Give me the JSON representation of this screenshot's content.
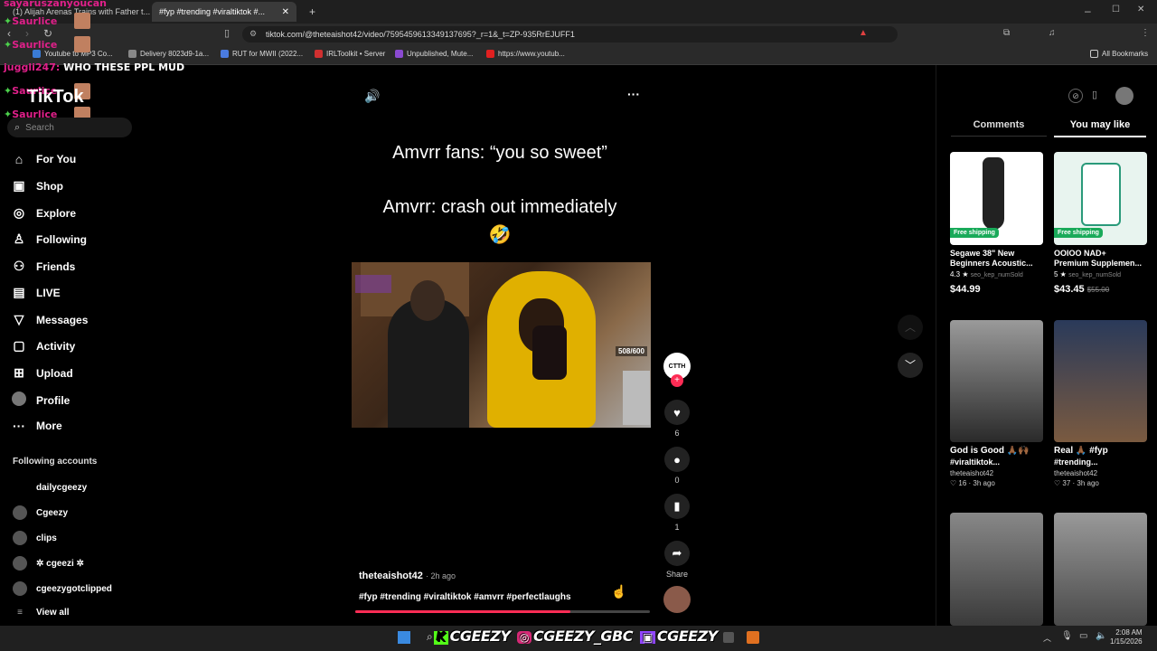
{
  "browser": {
    "tabs": [
      {
        "label": "(1) Alijah Arenas Trains with Father t..."
      },
      {
        "label": "#fyp #trending #viraltiktok #..."
      }
    ],
    "new_tab": "+",
    "url": "tiktok.com/@theteaishot42/video/7595459613349137695?_r=1&_t=ZP-935RrEJUFF1",
    "bookmarks": [
      "Youtube to MP3 Co...",
      "Delivery 8023d9-1a...",
      "RUT for MWII (2022...",
      "IRLToolkit • Server",
      "Unpublished, Mute...",
      "https://www.youtub..."
    ],
    "all_bookmarks": "All Bookmarks",
    "window_controls": [
      "–",
      "☐",
      "✕"
    ]
  },
  "stream_overlay": {
    "chat": [
      {
        "name": "sayaruszanyoucan",
        "color": "#e0208a"
      },
      {
        "name": "Saurlice",
        "color": "#e0208a"
      },
      {
        "name": "Saurlice",
        "color": "#e0208a"
      },
      {
        "name": "juggli247",
        "color": "#e0208a",
        "message": "WHO THESE PPL MUD"
      },
      {
        "name": "Saurlice",
        "color": "#e0208a"
      },
      {
        "name": "Saurlice",
        "color": "#e0208a"
      }
    ],
    "tags": [
      "CGEEZY",
      "CGEEZY_GBC",
      "CGEEZY"
    ]
  },
  "sidebar": {
    "logo": "TikTok",
    "search_placeholder": "Search",
    "items": [
      {
        "label": "For You",
        "icon": "home-icon"
      },
      {
        "label": "Shop",
        "icon": "bag-icon"
      },
      {
        "label": "Explore",
        "icon": "compass-icon"
      },
      {
        "label": "Following",
        "icon": "user-icon"
      },
      {
        "label": "Friends",
        "icon": "users-icon"
      },
      {
        "label": "LIVE",
        "icon": "live-icon"
      },
      {
        "label": "Messages",
        "icon": "send-icon"
      },
      {
        "label": "Activity",
        "icon": "message-icon"
      },
      {
        "label": "Upload",
        "icon": "plus-icon"
      },
      {
        "label": "Profile",
        "icon": "avatar-icon"
      },
      {
        "label": "More",
        "icon": "more-icon"
      }
    ],
    "following_title": "Following accounts",
    "following": [
      "dailycgeezy",
      "Cgeezy",
      "clips",
      "✲ cgeezi ✲",
      "cgeezygotclipped"
    ],
    "view_all": "View all"
  },
  "video": {
    "caption_line1": "Amvrr fans: “you so sweet”",
    "caption_line2": "Amvrr: crash out immediately",
    "emoji": "🤣",
    "viewer_badge": "508/600",
    "author": "theteaishot42",
    "posted": "· 2h ago",
    "hashtags": "#fyp #trending  #viraltiktok #amvrr #perfectlaughs",
    "progress": 0.73,
    "actions": {
      "avatar_text": "CTTH",
      "likes": "6",
      "comments": "0",
      "saves": "1",
      "share": "Share"
    }
  },
  "right_panel": {
    "tab_comments": "Comments",
    "tab_you_may_like": "You may like",
    "products": [
      {
        "title_1": "Segawe 38\" New",
        "title_2": "Beginners Acoustic...",
        "rating": "4.3 ★",
        "sold": "seo_kep_numSold",
        "price": "$44.99",
        "badge": "Free shipping"
      },
      {
        "title_1": "OOIOO NAD+",
        "title_2": "Premium Supplemen...",
        "rating": "5 ★",
        "sold": "seo_kep_numSold",
        "price": "$43.45",
        "old_price": "$55.00",
        "badge": "Free shipping"
      }
    ],
    "videos": [
      {
        "title_1": "God is Good 🙏🏾🙌🏾",
        "title_2": "#viraltiktok...",
        "author": "theteaishot42",
        "meta": "♡ 16 · 3h ago"
      },
      {
        "title_1": "Real 🙏🏾 #fyp",
        "title_2": "#trending...",
        "author": "theteaishot42",
        "meta": "♡ 37 · 3h ago"
      }
    ]
  },
  "taskbar": {
    "time": "2:08 AM",
    "date": "1/15/2026"
  }
}
